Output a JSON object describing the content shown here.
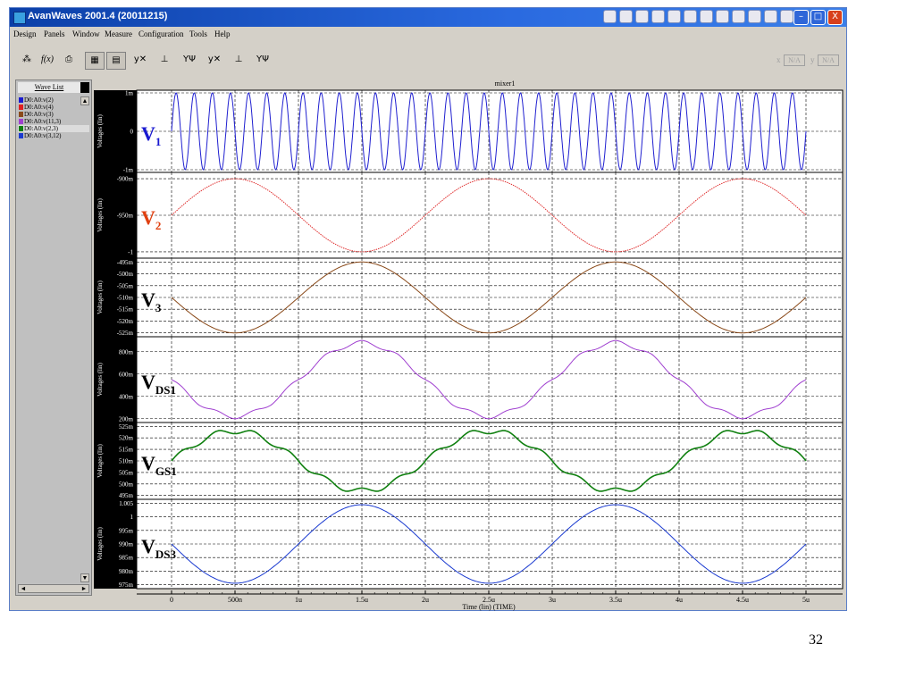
{
  "window": {
    "title": "AvanWaves 2001.4  (20011215)",
    "tray_icons": [
      "globe-icon",
      "refresh-icon",
      "paint-icon",
      "tools-icon",
      "shield-icon",
      "note-icon",
      "chart-icon",
      "search-icon",
      "check-icon",
      "person-icon",
      "magnifier-icon",
      "palette-icon",
      "help-icon"
    ],
    "minimize": "–",
    "maximize": "□",
    "close": "X"
  },
  "menu": [
    "Design",
    "Panels",
    "Window",
    "Measure",
    "Configuration",
    "Tools",
    "Help"
  ],
  "toolbar": {
    "buttons": [
      "hierarchy-icon",
      "function-icon",
      "printer-icon",
      "panel-icon",
      "panel-settings-icon",
      "y-zoom-icon",
      "x-zoom-icon",
      "y-measure-icon",
      "y-cross-icon",
      "x-measure-icon",
      "y-probe-icon"
    ],
    "function_label": "f(x)",
    "x_label": "x",
    "x_value": "N/A",
    "y_label": "y",
    "y_value": "N/A"
  },
  "wave_list": {
    "title": "Wave List",
    "items": [
      {
        "label": "D0:A0:v(2)",
        "color": "#1a1ad0"
      },
      {
        "label": "D0:A0:v(4)",
        "color": "#e02020"
      },
      {
        "label": "D0:A0:v(3)",
        "color": "#8a4a1a"
      },
      {
        "label": "D0:A0:v(11,3)",
        "color": "#a040d0"
      },
      {
        "label": "D0:A0:v(2,3)",
        "color": "#108010"
      },
      {
        "label": "D0:A0:v(3,12)",
        "color": "#1a3ad0"
      }
    ],
    "selected_index": 4,
    "scroll_up": "▲",
    "scroll_down": "▼",
    "scroll_left": "◄",
    "scroll_right": "►"
  },
  "plot_title": "mixer1",
  "ylabel": "Voltages (lin)",
  "xlabel": "Time (lin) (TIME)",
  "figure_number": "32",
  "chart_data": [
    {
      "type": "line",
      "name": "V1",
      "series_label": "V",
      "series_sub": "1",
      "label_color": "#1a1ad0",
      "line_color": "#2020d0",
      "yticks": [
        "1m",
        "0",
        "-1m"
      ],
      "ylim": [
        -0.001,
        0.001
      ],
      "tick_values": [
        0.001,
        0,
        -0.001
      ],
      "waveform": {
        "offset": 0,
        "amplitude": 0.001,
        "periods_in_window": 35,
        "phase": "sine",
        "ripple": 0
      }
    },
    {
      "type": "line",
      "name": "V2",
      "series_label": "V",
      "series_sub": "2",
      "label_color": "#e04010",
      "line_color": "#e03030",
      "dashed": true,
      "yticks": [
        "-900m",
        "-950m",
        "-1"
      ],
      "ylim": [
        -1.005,
        -0.895
      ],
      "tick_values": [
        -0.9,
        -0.95,
        -1.0
      ],
      "waveform": {
        "offset": -0.95,
        "amplitude": 0.05,
        "period_us": 2,
        "peak_at_us": 0.5,
        "ripple": 0
      }
    },
    {
      "type": "line",
      "name": "V3",
      "series_label": "V",
      "series_sub": "3",
      "label_color": "#000000",
      "line_color": "#8a4a1a",
      "yticks": [
        "-495m",
        "-500m",
        "-505m",
        "-510m",
        "-515m",
        "-520m",
        "-525m"
      ],
      "ylim": [
        -0.5255,
        -0.4945
      ],
      "tick_values": [
        -0.495,
        -0.5,
        -0.505,
        -0.51,
        -0.515,
        -0.52,
        -0.525
      ],
      "waveform": {
        "offset": -0.51,
        "amplitude": 0.015,
        "period_us": 2,
        "peak_at_us": 1.5,
        "ripple": 0
      }
    },
    {
      "type": "line",
      "name": "VDS1",
      "series_label": "V",
      "series_sub": "DS1",
      "label_color": "#000000",
      "line_color": "#a040d0",
      "yticks": [
        "800m",
        "600m",
        "400m",
        "200m"
      ],
      "ylim": [
        0.19,
        0.91
      ],
      "tick_values": [
        0.8,
        0.6,
        0.4,
        0.2
      ],
      "waveform": {
        "offset": 0.55,
        "amplitude": 0.33,
        "period_us": 2,
        "peak_at_us": 1.5,
        "ripple": 0.02
      }
    },
    {
      "type": "line",
      "name": "VGS1",
      "series_label": "V",
      "series_sub": "GS1",
      "label_color": "#000000",
      "line_color": "#108010",
      "yticks": [
        "525m",
        "520m",
        "515m",
        "510m",
        "505m",
        "500m",
        "495m"
      ],
      "ylim": [
        0.4945,
        0.5255
      ],
      "tick_values": [
        0.525,
        0.52,
        0.515,
        0.51,
        0.505,
        0.5,
        0.495
      ],
      "waveform": {
        "offset": 0.51,
        "amplitude": 0.013,
        "period_us": 2,
        "peak_at_us": 0.5,
        "ripple": 0.0012
      }
    },
    {
      "type": "line",
      "name": "VDS3",
      "series_label": "V",
      "series_sub": "DS3",
      "label_color": "#000000",
      "line_color": "#1a3ad0",
      "yticks": [
        "1.005",
        "1",
        "995m",
        "990m",
        "985m",
        "980m",
        "975m"
      ],
      "ylim": [
        0.9745,
        1.0055
      ],
      "tick_values": [
        1.005,
        1.0,
        0.995,
        0.99,
        0.985,
        0.98,
        0.975
      ],
      "waveform": {
        "offset": 0.99,
        "amplitude": 0.0145,
        "period_us": 2,
        "peak_at_us": 1.5,
        "ripple": 0
      }
    }
  ],
  "xaxis": {
    "xlim": [
      0,
      5
    ],
    "ticks": [
      "0",
      "500n",
      "1u",
      "1.5u",
      "2u",
      "2.5u",
      "3u",
      "3.5u",
      "4u",
      "4.5u",
      "5u"
    ],
    "tick_values": [
      0,
      0.5,
      1,
      1.5,
      2,
      2.5,
      3,
      3.5,
      4,
      4.5,
      5
    ]
  }
}
